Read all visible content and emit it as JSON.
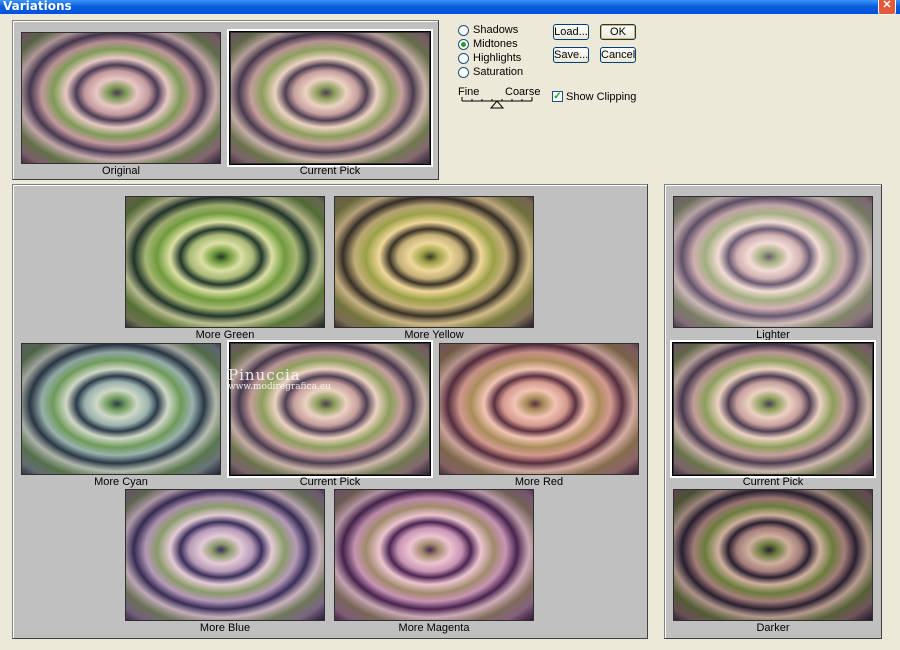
{
  "window": {
    "title": "Variations",
    "close_glyph": "✕"
  },
  "top_panel": {
    "original_label": "Original",
    "current_pick_label": "Current Pick"
  },
  "tones": {
    "options": [
      "Shadows",
      "Midtones",
      "Highlights",
      "Saturation"
    ],
    "selected": "Midtones"
  },
  "slider": {
    "fine_label": "Fine",
    "coarse_label": "Coarse"
  },
  "buttons": {
    "load": "Load...",
    "ok": "OK",
    "save": "Save...",
    "cancel": "Cancel"
  },
  "show_clipping": {
    "label": "Show Clipping",
    "checked": true
  },
  "color_grid": {
    "more_green": "More Green",
    "more_yellow": "More Yellow",
    "more_cyan": "More Cyan",
    "current_pick": "Current Pick",
    "more_red": "More Red",
    "more_blue": "More Blue",
    "more_magenta": "More Magenta"
  },
  "brightness": {
    "lighter": "Lighter",
    "current_pick": "Current Pick",
    "darker": "Darker"
  },
  "watermark": {
    "line1": "Pinuccia",
    "line2": "www.modiregrafica.eu"
  }
}
